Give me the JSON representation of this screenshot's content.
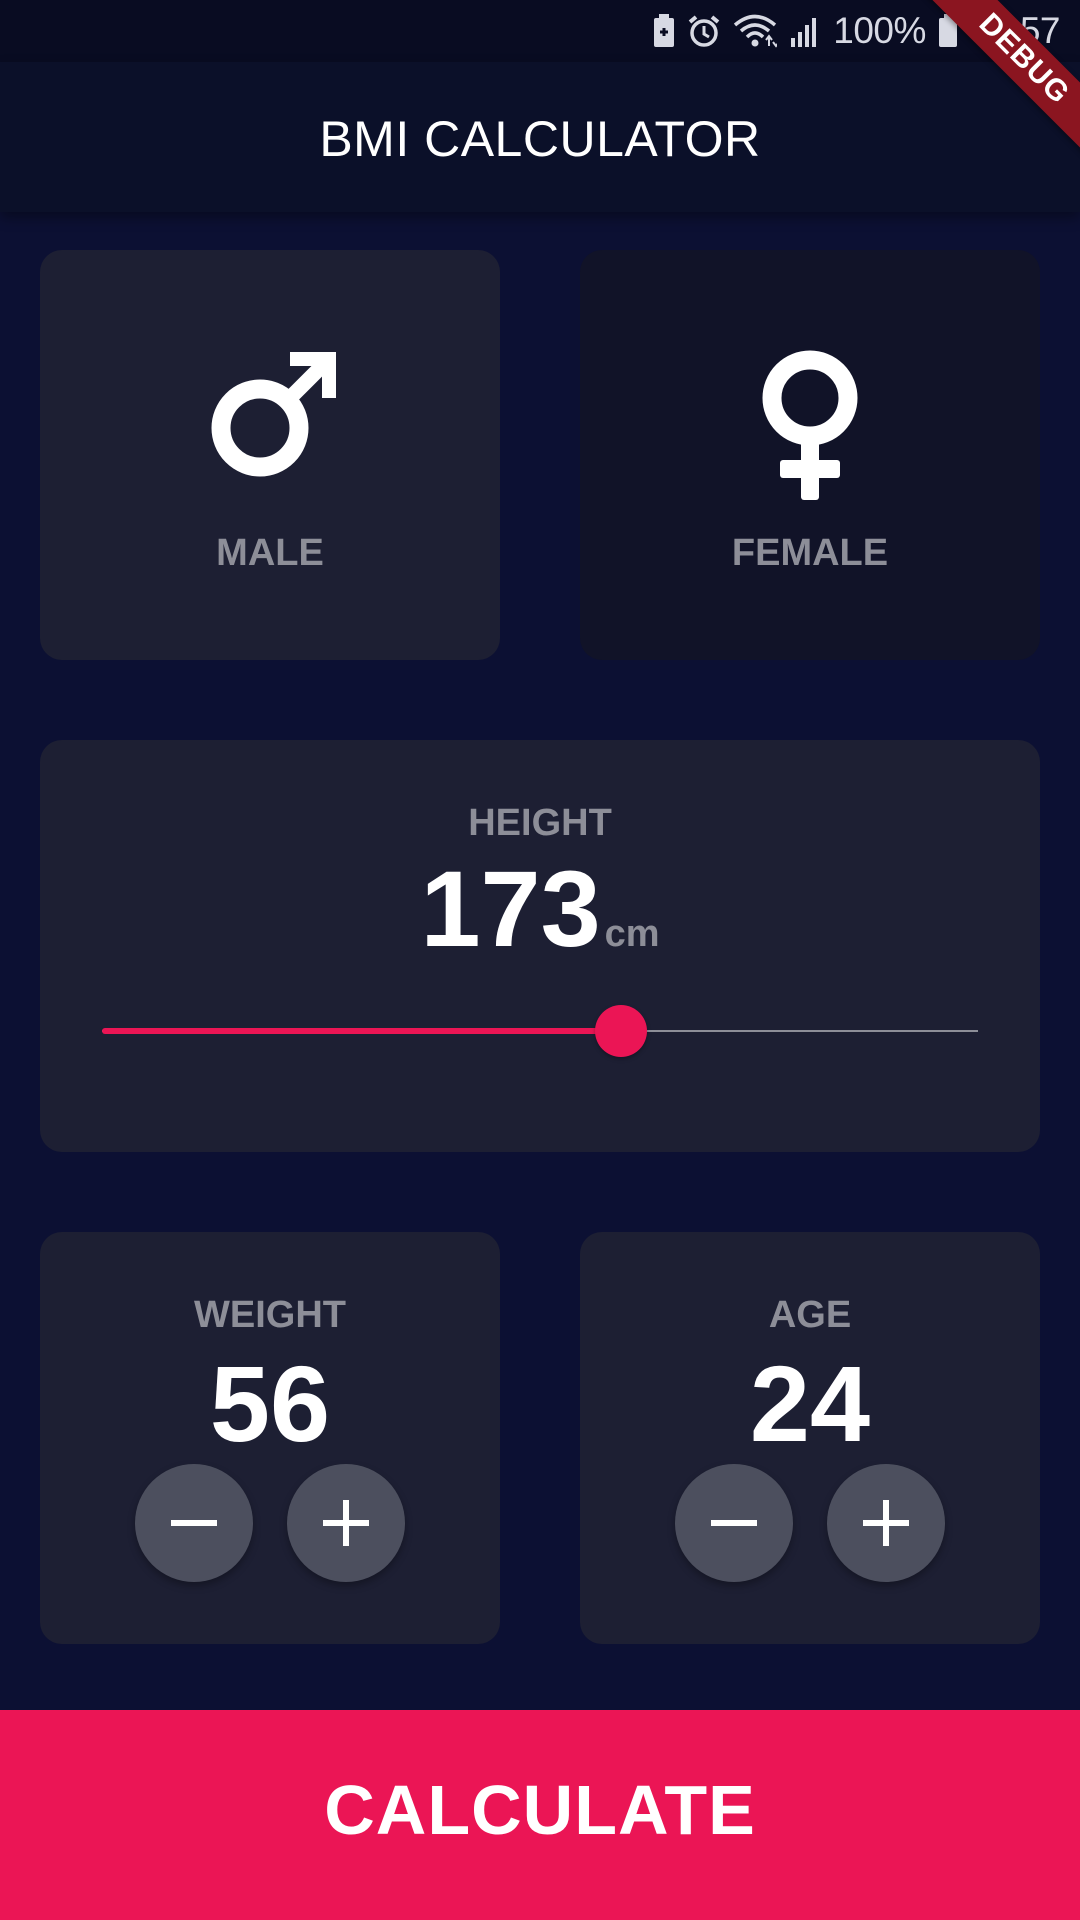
{
  "status_bar": {
    "battery_percent": "100%",
    "time": "00:57",
    "icons": [
      "battery-saver-icon",
      "alarm-icon",
      "wifi-icon",
      "signal-icon",
      "battery-icon"
    ]
  },
  "debug_banner": "DEBUG",
  "app_bar": {
    "title": "BMI CALCULATOR"
  },
  "gender": {
    "male": {
      "label": "MALE",
      "icon": "male-icon",
      "selected": true
    },
    "female": {
      "label": "FEMALE",
      "icon": "female-icon",
      "selected": false
    }
  },
  "height": {
    "label": "HEIGHT",
    "value": "173",
    "unit": "cm",
    "slider_fraction": 0.593
  },
  "weight": {
    "label": "WEIGHT",
    "value": "56",
    "minus_icon": "minus-icon",
    "plus_icon": "plus-icon"
  },
  "age": {
    "label": "AGE",
    "value": "24",
    "minus_icon": "minus-icon",
    "plus_icon": "plus-icon"
  },
  "calculate_button": {
    "label": "CALCULATE"
  },
  "colors": {
    "background": "#0C1033",
    "active_card": "#1D1F33",
    "inactive_card": "#111328",
    "accent": "#EB1555",
    "label": "#8D8E98",
    "round_button": "#4C4F5E"
  }
}
